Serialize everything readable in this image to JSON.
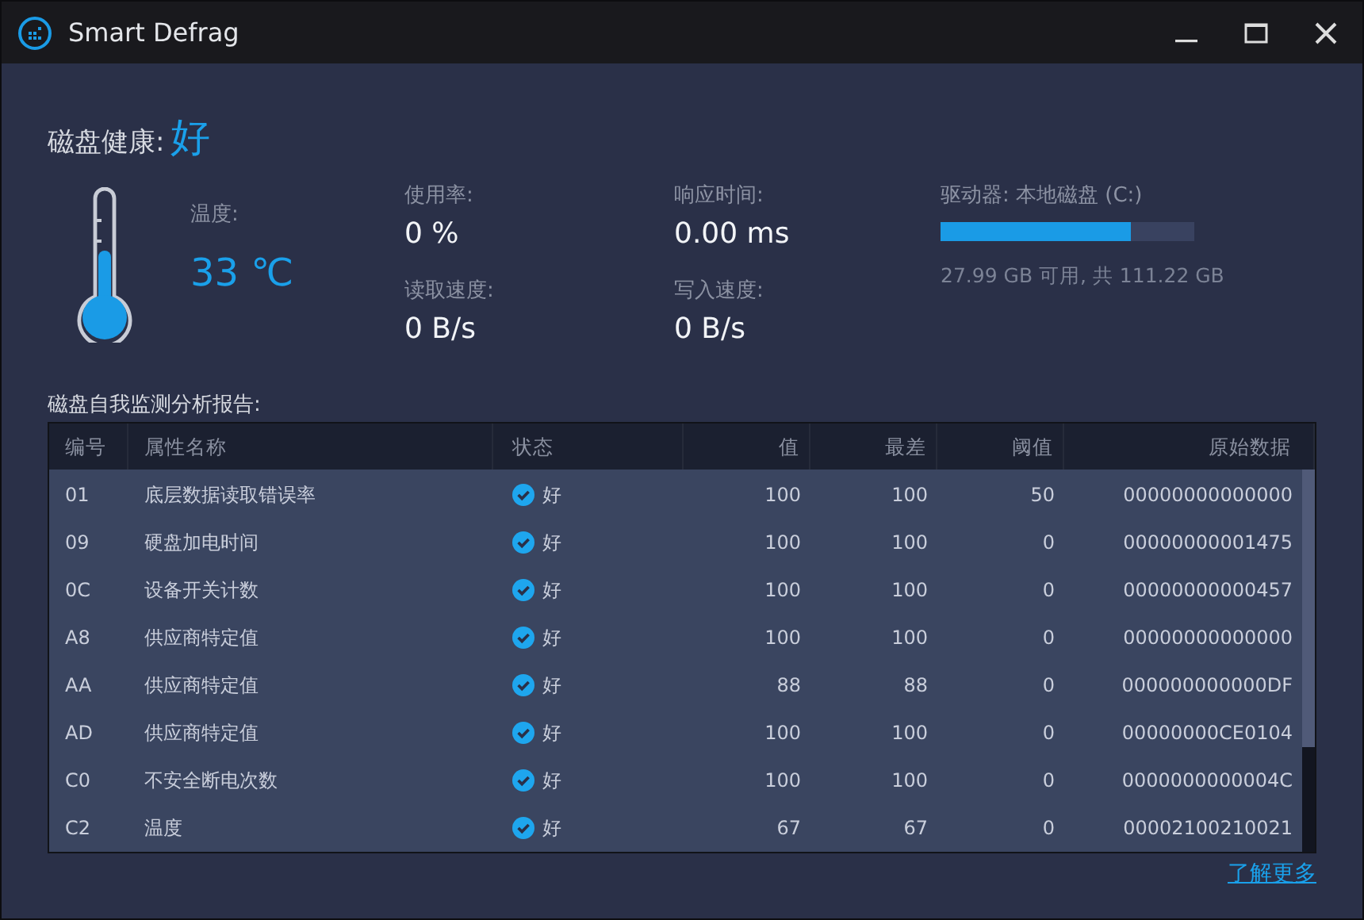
{
  "window": {
    "title": "Smart Defrag"
  },
  "health": {
    "label": "磁盘健康:",
    "value": "好"
  },
  "temperature": {
    "label": "温度:",
    "value": "33 ℃"
  },
  "stats": [
    {
      "label": "使用率:",
      "value": "0 %"
    },
    {
      "label": "响应时间:",
      "value": "0.00 ms"
    },
    {
      "label": "读取速度:",
      "value": "0 B/s"
    },
    {
      "label": "写入速度:",
      "value": "0 B/s"
    }
  ],
  "drive": {
    "label": "驱动器: 本地磁盘 (C:)",
    "level": 0.75,
    "space": "27.99 GB 可用, 共 111.22 GB"
  },
  "report_title": "磁盘自我监测分析报告:",
  "table": {
    "columns": [
      "编号",
      "属性名称",
      "状态",
      "值",
      "最差",
      "阈值",
      "原始数据"
    ],
    "rows": [
      {
        "id": "01",
        "name": "底层数据读取错误率",
        "status": "好",
        "value": "100",
        "worst": "100",
        "threshold": "50",
        "raw": "00000000000000"
      },
      {
        "id": "09",
        "name": "硬盘加电时间",
        "status": "好",
        "value": "100",
        "worst": "100",
        "threshold": "0",
        "raw": "00000000001475"
      },
      {
        "id": "0C",
        "name": "设备开关计数",
        "status": "好",
        "value": "100",
        "worst": "100",
        "threshold": "0",
        "raw": "00000000000457"
      },
      {
        "id": "A8",
        "name": "供应商特定值",
        "status": "好",
        "value": "100",
        "worst": "100",
        "threshold": "0",
        "raw": "00000000000000"
      },
      {
        "id": "AA",
        "name": "供应商特定值",
        "status": "好",
        "value": "88",
        "worst": "88",
        "threshold": "0",
        "raw": "000000000000DF"
      },
      {
        "id": "AD",
        "name": "供应商特定值",
        "status": "好",
        "value": "100",
        "worst": "100",
        "threshold": "0",
        "raw": "00000000CE0104"
      },
      {
        "id": "C0",
        "name": "不安全断电次数",
        "status": "好",
        "value": "100",
        "worst": "100",
        "threshold": "0",
        "raw": "0000000000004C"
      },
      {
        "id": "C2",
        "name": "温度",
        "status": "好",
        "value": "67",
        "worst": "67",
        "threshold": "0",
        "raw": "00002100210021"
      }
    ]
  },
  "learn_more": "了解更多"
}
